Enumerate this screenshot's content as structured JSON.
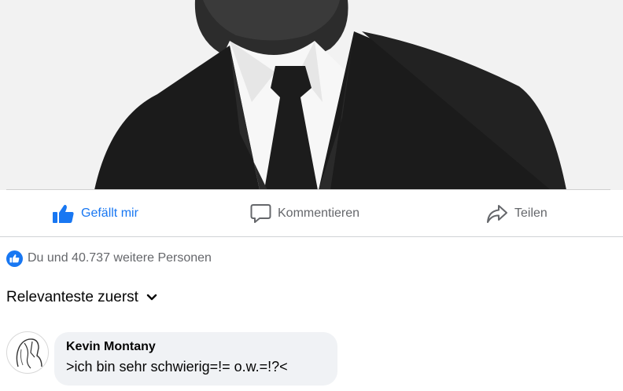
{
  "post": {
    "actions": {
      "like_label": "Gefällt mir",
      "comment_label": "Kommentieren",
      "share_label": "Teilen"
    },
    "reactions_text": "Du und 40.737 weitere Personen"
  },
  "comments": {
    "sort_label": "Relevanteste zuerst",
    "items": [
      {
        "author": "Kevin Montany",
        "text": ">ich bin sehr schwierig=!= o.w.=!?<"
      }
    ]
  },
  "colors": {
    "accent": "#1877f2",
    "muted_text": "#65676b",
    "bubble_bg": "#f0f2f5"
  },
  "icons": {
    "like": "thumbs-up-icon",
    "comment": "speech-bubble-icon",
    "share": "share-arrow-icon",
    "sort": "chevron-down-icon"
  }
}
